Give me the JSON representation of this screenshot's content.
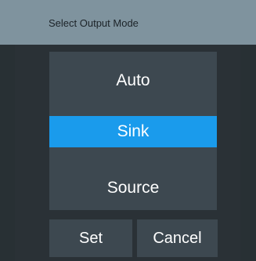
{
  "dialog": {
    "title": "Select Output Mode"
  },
  "options": [
    {
      "label": "Auto",
      "selected": false
    },
    {
      "label": "Sink",
      "selected": true
    },
    {
      "label": "Source",
      "selected": false
    }
  ],
  "buttons": {
    "set_label": "Set",
    "cancel_label": "Cancel"
  },
  "colors": {
    "title_bar": "#7f939e",
    "background": "#2a3136",
    "panel": "#3d4850",
    "selection": "#1a9bec",
    "text": "#ffffff"
  }
}
